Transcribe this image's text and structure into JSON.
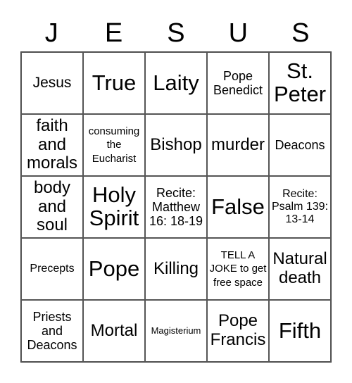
{
  "header": {
    "letters": [
      "J",
      "E",
      "S",
      "U",
      "S"
    ]
  },
  "cells": [
    [
      "Jesus",
      "True",
      "Laity",
      "Pope Benedict",
      "St. Peter"
    ],
    [
      "faith and morals",
      "consuming the Eucharist",
      "Bishop",
      "murder",
      "Deacons"
    ],
    [
      "body and soul",
      "Holy Spirit",
      "Recite: Matthew 16: 18-19",
      "False",
      "Recite: Psalm 139: 13-14"
    ],
    [
      "Precepts",
      "Pope",
      "Killing",
      "TELL A JOKE to get free space",
      "Natural death"
    ],
    [
      "Priests and Deacons",
      "Mortal",
      "Magisterium",
      "Pope Francis",
      "Fifth"
    ]
  ]
}
